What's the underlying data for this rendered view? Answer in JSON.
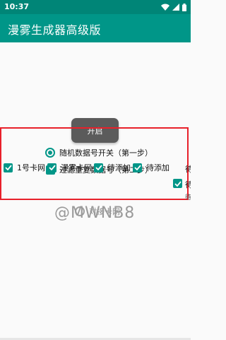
{
  "status_bar": {
    "time": "10:37",
    "icons": [
      "wifi-icon",
      "signal-icon",
      "battery-icon"
    ]
  },
  "app_bar": {
    "title": "漫雾生成器高级版",
    "color": "#009688"
  },
  "start_button": {
    "label": "开启"
  },
  "options": {
    "random_number_switch": {
      "label": "随机数据号开关（第一步）",
      "selected": true
    },
    "filter_duplicates": {
      "label": "过滤重复数据号（第二步）",
      "checked": true
    },
    "row_items": [
      {
        "label": "1号卡网",
        "checked": true
      },
      {
        "label": "漫雾卡网",
        "checked": true
      },
      {
        "label": "待添加",
        "checked": true
      },
      {
        "label": "待添加",
        "checked": true
      }
    ],
    "connect_card_net": {
      "label": "对接卡网",
      "selected": false
    }
  },
  "watermark": "@MWNB8",
  "colors": {
    "accent": "#009688",
    "highlight": "#e8202a",
    "status_bar": "#008577"
  }
}
